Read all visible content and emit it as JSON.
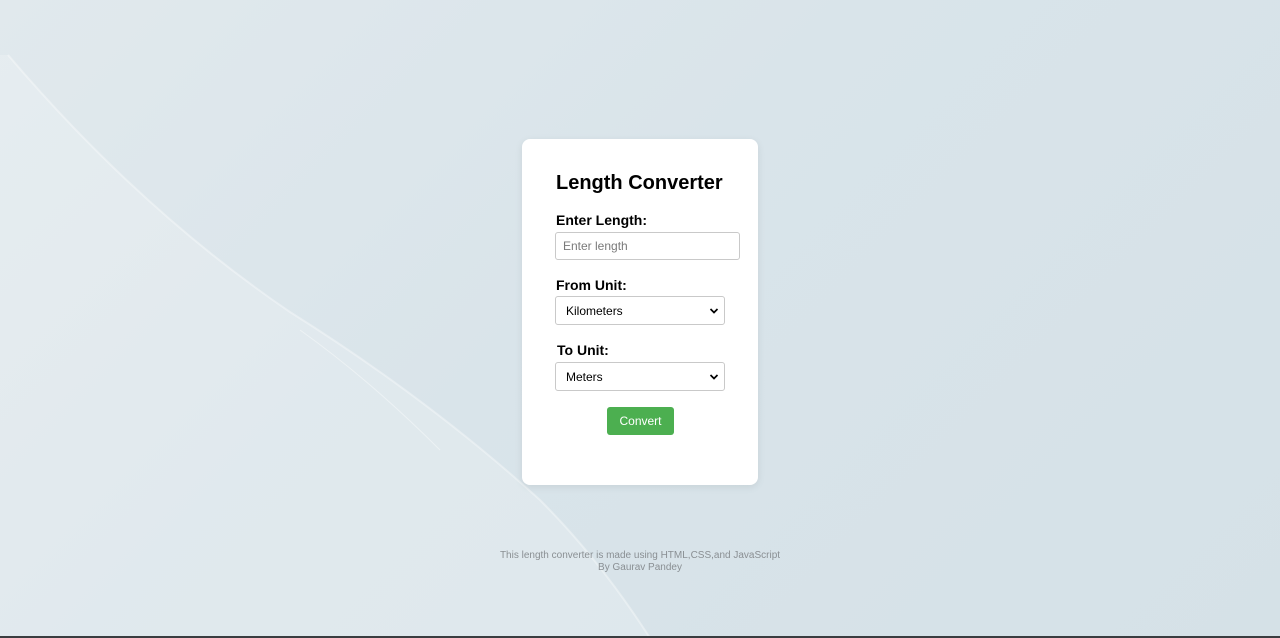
{
  "converter": {
    "title": "Length Converter",
    "length_label": "Enter Length:",
    "length_placeholder": "Enter length",
    "length_value": "",
    "from_label": "From Unit:",
    "from_selected": "Kilometers",
    "to_label": "To Unit:",
    "to_selected": "Meters",
    "convert_label": "Convert"
  },
  "footer": {
    "line1": "This length converter is made using HTML,CSS,and JavaScript",
    "line2": "By Gaurav Pandey"
  },
  "colors": {
    "button": "#4caf50",
    "card": "#ffffff",
    "background": "#dbe5ea"
  },
  "icons": {
    "select_arrow": "chevron-down-icon"
  }
}
